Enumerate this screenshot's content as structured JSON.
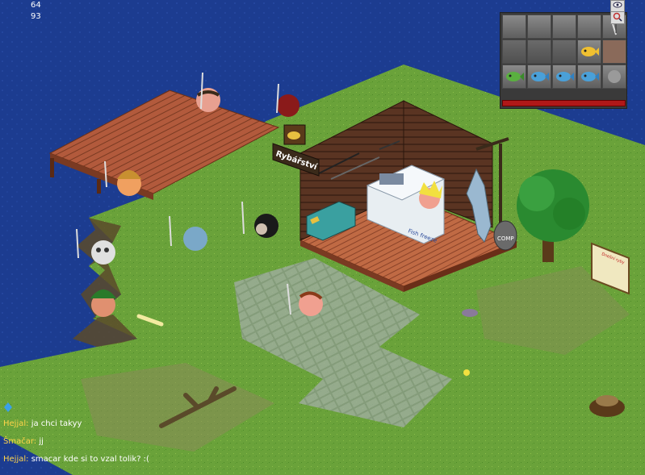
{
  "hud": {
    "coord_x": "64",
    "coord_y": "93"
  },
  "shop": {
    "sign": "Rybářství",
    "fridge_label": "Fish freeze",
    "bin_label": "COMP"
  },
  "board": {
    "title": "Dnešní ryby"
  },
  "inventory": {
    "buttons": [
      "eye-icon",
      "search-icon"
    ],
    "slots": [
      "",
      "",
      "",
      "",
      "fishing-rod-icon",
      "",
      "",
      "",
      "yellow-fish-icon",
      "",
      "green-fish-icon",
      "blue-fish-icon",
      "blue-fish-icon",
      "blue-fish-icon",
      ""
    ]
  },
  "chat": [
    {
      "name": "Hejjal:",
      "message": "ja chci takyy"
    },
    {
      "name": "Šmačar:",
      "message": "jj"
    },
    {
      "name": "Hejjal:",
      "message": "smacar kde si to vzal tolik? :("
    }
  ],
  "colors": {
    "water": "#1a3a8a",
    "grass": "#6aa03a",
    "wood": "#b05a3a",
    "chat_name": "#ffd44a"
  }
}
